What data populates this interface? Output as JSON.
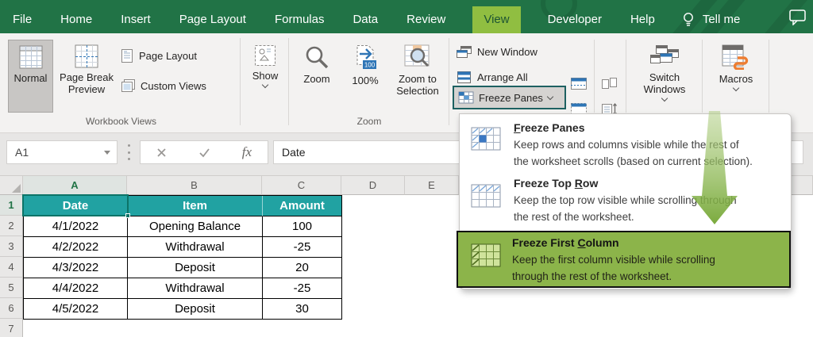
{
  "menu": {
    "tabs": [
      "File",
      "Home",
      "Insert",
      "Page Layout",
      "Formulas",
      "Data",
      "Review",
      "View",
      "Developer",
      "Help"
    ],
    "active_tab": "View",
    "tellme_label": "Tell me"
  },
  "ribbon": {
    "workbook_views": {
      "normal": "Normal",
      "page_break_preview": "Page Break Preview",
      "page_layout": "Page Layout",
      "custom_views": "Custom Views",
      "group_label": "Workbook Views"
    },
    "show": {
      "label": "Show"
    },
    "zoom_group": {
      "zoom": "Zoom",
      "hundred": "100%",
      "hundred_badge": "100",
      "zoom_to_selection": "Zoom to Selection",
      "group_label": "Zoom"
    },
    "window_group": {
      "new_window": "New Window",
      "arrange_all": "Arrange All",
      "freeze_panes": "Freeze Panes",
      "switch_windows": "Switch Windows",
      "macros": "Macros"
    }
  },
  "formula_bar": {
    "name_box": "A1",
    "fx_label": "fx",
    "value": "Date"
  },
  "sheet": {
    "column_headers": [
      "A",
      "B",
      "C",
      "D",
      "E"
    ],
    "row_headers": [
      "1",
      "2",
      "3",
      "4",
      "5",
      "6",
      "7"
    ],
    "header_row": [
      "Date",
      "Item",
      "Amount"
    ],
    "data": [
      [
        "4/1/2022",
        "Opening Balance",
        "100"
      ],
      [
        "4/2/2022",
        "Withdrawal",
        "-25"
      ],
      [
        "4/3/2022",
        "Deposit",
        "20"
      ],
      [
        "4/4/2022",
        "Withdrawal",
        "-25"
      ],
      [
        "4/5/2022",
        "Deposit",
        "30"
      ]
    ]
  },
  "dropdown": {
    "items": [
      {
        "title_pre": "",
        "title_u": "F",
        "title_post": "reeze Panes",
        "desc1": "Keep rows and columns visible while the rest of",
        "desc2": "the worksheet scrolls (based on current selection)."
      },
      {
        "title_pre": "Freeze Top ",
        "title_u": "R",
        "title_post": "ow",
        "desc1": "Keep the top row visible while scrolling through",
        "desc2": "the rest of the worksheet."
      },
      {
        "title_pre": "Freeze First ",
        "title_u": "C",
        "title_post": "olumn",
        "desc1": "Keep the first column visible while scrolling",
        "desc2": "through the rest of the worksheet."
      }
    ]
  },
  "colors": {
    "excel_green": "#217346",
    "active_tab_green": "#90be41",
    "table_header_teal": "#21a2a2",
    "dropdown_highlight_green": "#8cb44a",
    "selection_border_teal": "#0c7468",
    "icon_blue": "#2e75b6",
    "macros_orange": "#ed7d31",
    "arrow_green": "#7fb43c"
  }
}
